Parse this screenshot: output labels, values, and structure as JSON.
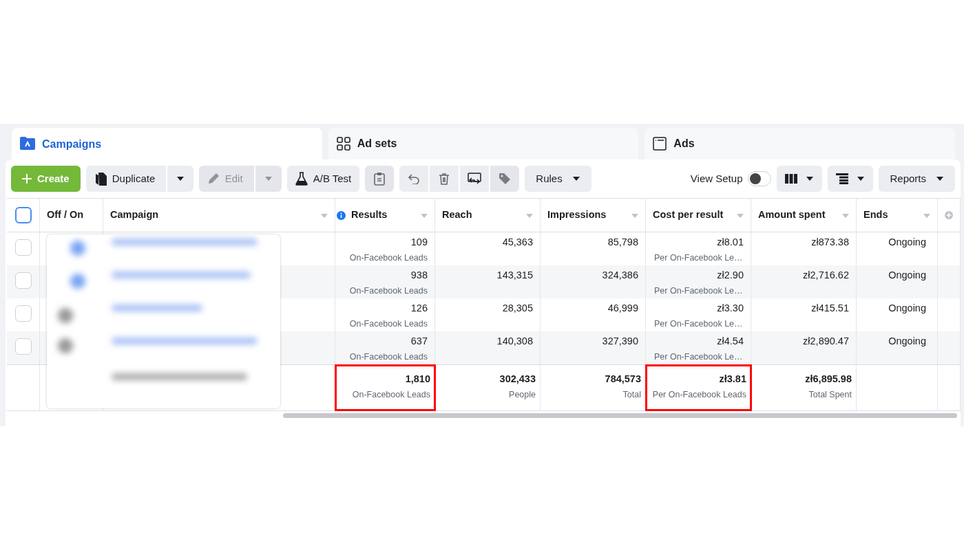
{
  "tabs": [
    {
      "kind": "campaigns",
      "label": "Campaigns",
      "selected": true
    },
    {
      "kind": "adsets",
      "label": "Ad sets",
      "selected": false
    },
    {
      "kind": "ads",
      "label": "Ads",
      "selected": false
    }
  ],
  "toolbar": [
    {
      "kind": "create",
      "label": "Create"
    },
    {
      "kind": "duplicate",
      "label": "Duplicate",
      "disabled": false
    },
    {
      "kind": "edit",
      "label": "Edit",
      "disabled": true
    },
    {
      "kind": "abtest",
      "label": "A/B Test"
    },
    {
      "kind": "clipboard"
    },
    {
      "kind": "undo"
    },
    {
      "kind": "delete"
    },
    {
      "kind": "swap"
    },
    {
      "kind": "tag"
    },
    {
      "kind": "rules",
      "label": "Rules"
    }
  ],
  "view_setup": {
    "label": "View Setup",
    "on": false
  },
  "right_tools": [
    {
      "kind": "columns"
    },
    {
      "kind": "breakdown"
    },
    {
      "kind": "reports",
      "label": "Reports"
    }
  ],
  "table": {
    "select_all": {
      "checked": false
    },
    "columns": [
      {
        "label": "Off / On",
        "sortable": false
      },
      {
        "label": "Campaign",
        "sortable": true
      },
      {
        "label": "Results",
        "sortable": true,
        "info": true
      },
      {
        "label": "Reach",
        "sortable": true
      },
      {
        "label": "Impressions",
        "sortable": true
      },
      {
        "label": "Cost per result",
        "sortable": true
      },
      {
        "label": "Amount spent",
        "sortable": true
      },
      {
        "label": "Ends",
        "sortable": true
      }
    ],
    "rows": [
      {
        "checked": false,
        "results": "109",
        "results_sub": "On-Facebook Leads",
        "reach": "45,363",
        "impressions": "85,798",
        "cost": "zł8.01",
        "cost_sub": "Per On-Facebook Le…",
        "spent": "zł873.38",
        "ends": "Ongoing"
      },
      {
        "checked": false,
        "results": "938",
        "results_sub": "On-Facebook Leads",
        "reach": "143,315",
        "impressions": "324,386",
        "cost": "zł2.90",
        "cost_sub": "Per On-Facebook Le…",
        "spent": "zł2,716.62",
        "ends": "Ongoing"
      },
      {
        "checked": false,
        "results": "126",
        "results_sub": "On-Facebook Leads",
        "reach": "28,305",
        "impressions": "46,999",
        "cost": "zł3.30",
        "cost_sub": "Per On-Facebook Le…",
        "spent": "zł415.51",
        "ends": "Ongoing"
      },
      {
        "checked": false,
        "results": "637",
        "results_sub": "On-Facebook Leads",
        "reach": "140,308",
        "impressions": "327,390",
        "cost": "zł4.54",
        "cost_sub": "Per On-Facebook Le…",
        "spent": "zł2,890.47",
        "ends": "Ongoing"
      }
    ],
    "totals": [
      {
        "value": "1,810",
        "sub": "On-Facebook Leads",
        "highlighted": true
      },
      {
        "value": "302,433",
        "sub": "People",
        "highlighted": false
      },
      {
        "value": "784,573",
        "sub": "Total",
        "highlighted": false
      },
      {
        "value": "zł3.81",
        "sub": "Per On-Facebook Leads",
        "highlighted": true
      },
      {
        "value": "zł6,895.98",
        "sub": "Total Spent",
        "highlighted": false
      }
    ]
  }
}
